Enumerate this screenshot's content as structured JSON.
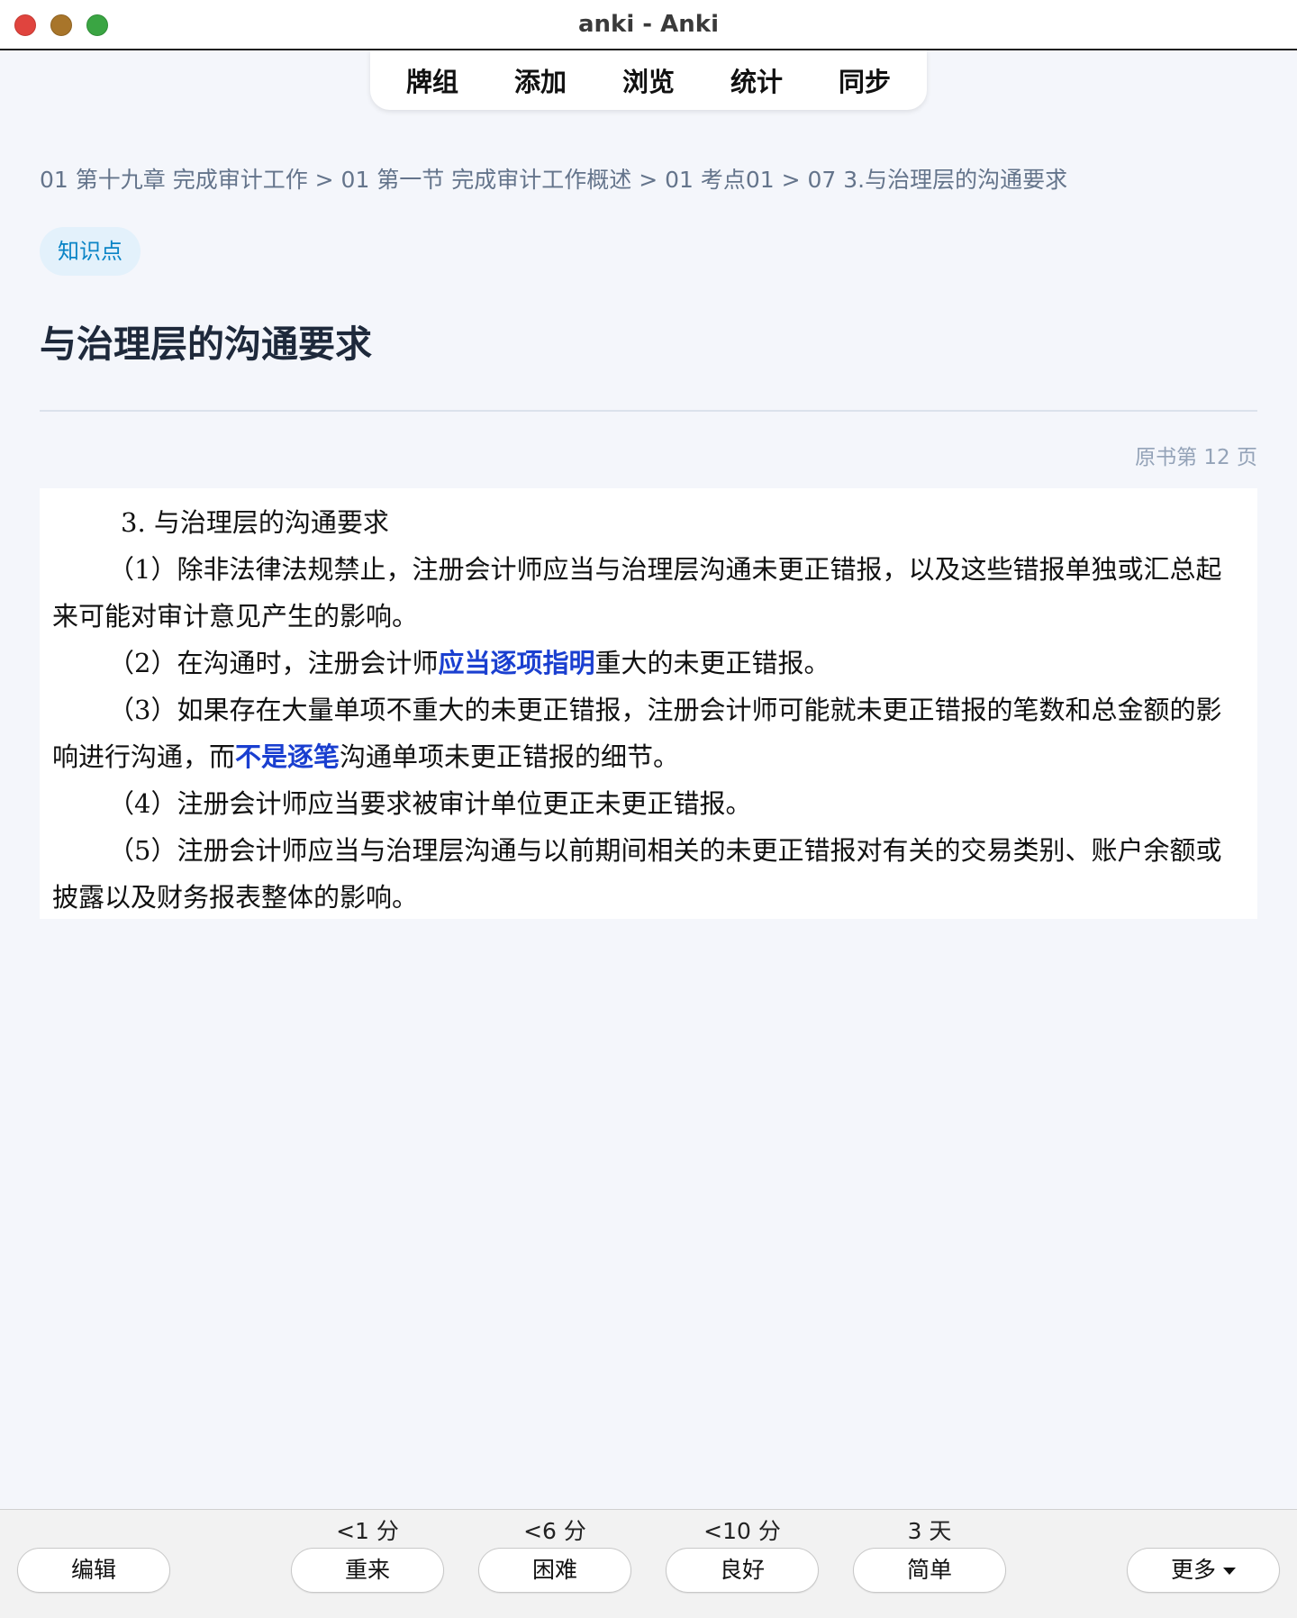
{
  "window": {
    "title": "anki - Anki"
  },
  "topnav": {
    "items": [
      "牌组",
      "添加",
      "浏览",
      "统计",
      "同步"
    ]
  },
  "card": {
    "breadcrumb": "01 第十九章 完成审计工作 > 01 第一节 完成审计工作概述 > 01 考点01 > 07 3.与治理层的沟通要求",
    "tag": "知识点",
    "title": "与治理层的沟通要求",
    "page_ref": "原书第 12 页",
    "excerpt": {
      "heading": "3. 与治理层的沟通要求",
      "p1": "（1）除非法律法规禁止，注册会计师应当与治理层沟通未更正错报，以及这些错报单独或汇总起来可能对审计意见产生的影响。",
      "p2_a": "（2）在沟通时，注册会计师",
      "p2_hl": "应当逐项指明",
      "p2_b": "重大的未更正错报。",
      "p3_a": "（3）如果存在大量单项不重大的未更正错报，注册会计师可能就未更正错报的笔数和总金额的影响进行沟通，而",
      "p3_hl": "不是逐笔",
      "p3_b": "沟通单项未更正错报的细节。",
      "p4": "（4）注册会计师应当要求被审计单位更正未更正错报。",
      "p5": "（5）注册会计师应当与治理层沟通与以前期间相关的未更正错报对有关的交易类别、账户余额或披露以及财务报表整体的影响。"
    }
  },
  "answer_bar": {
    "edit": "编辑",
    "again": {
      "label": "重来",
      "interval": "<1 分"
    },
    "hard": {
      "label": "困难",
      "interval": "<6 分"
    },
    "good": {
      "label": "良好",
      "interval": "<10 分"
    },
    "easy": {
      "label": "简单",
      "interval": "3 天"
    },
    "more": "更多"
  }
}
